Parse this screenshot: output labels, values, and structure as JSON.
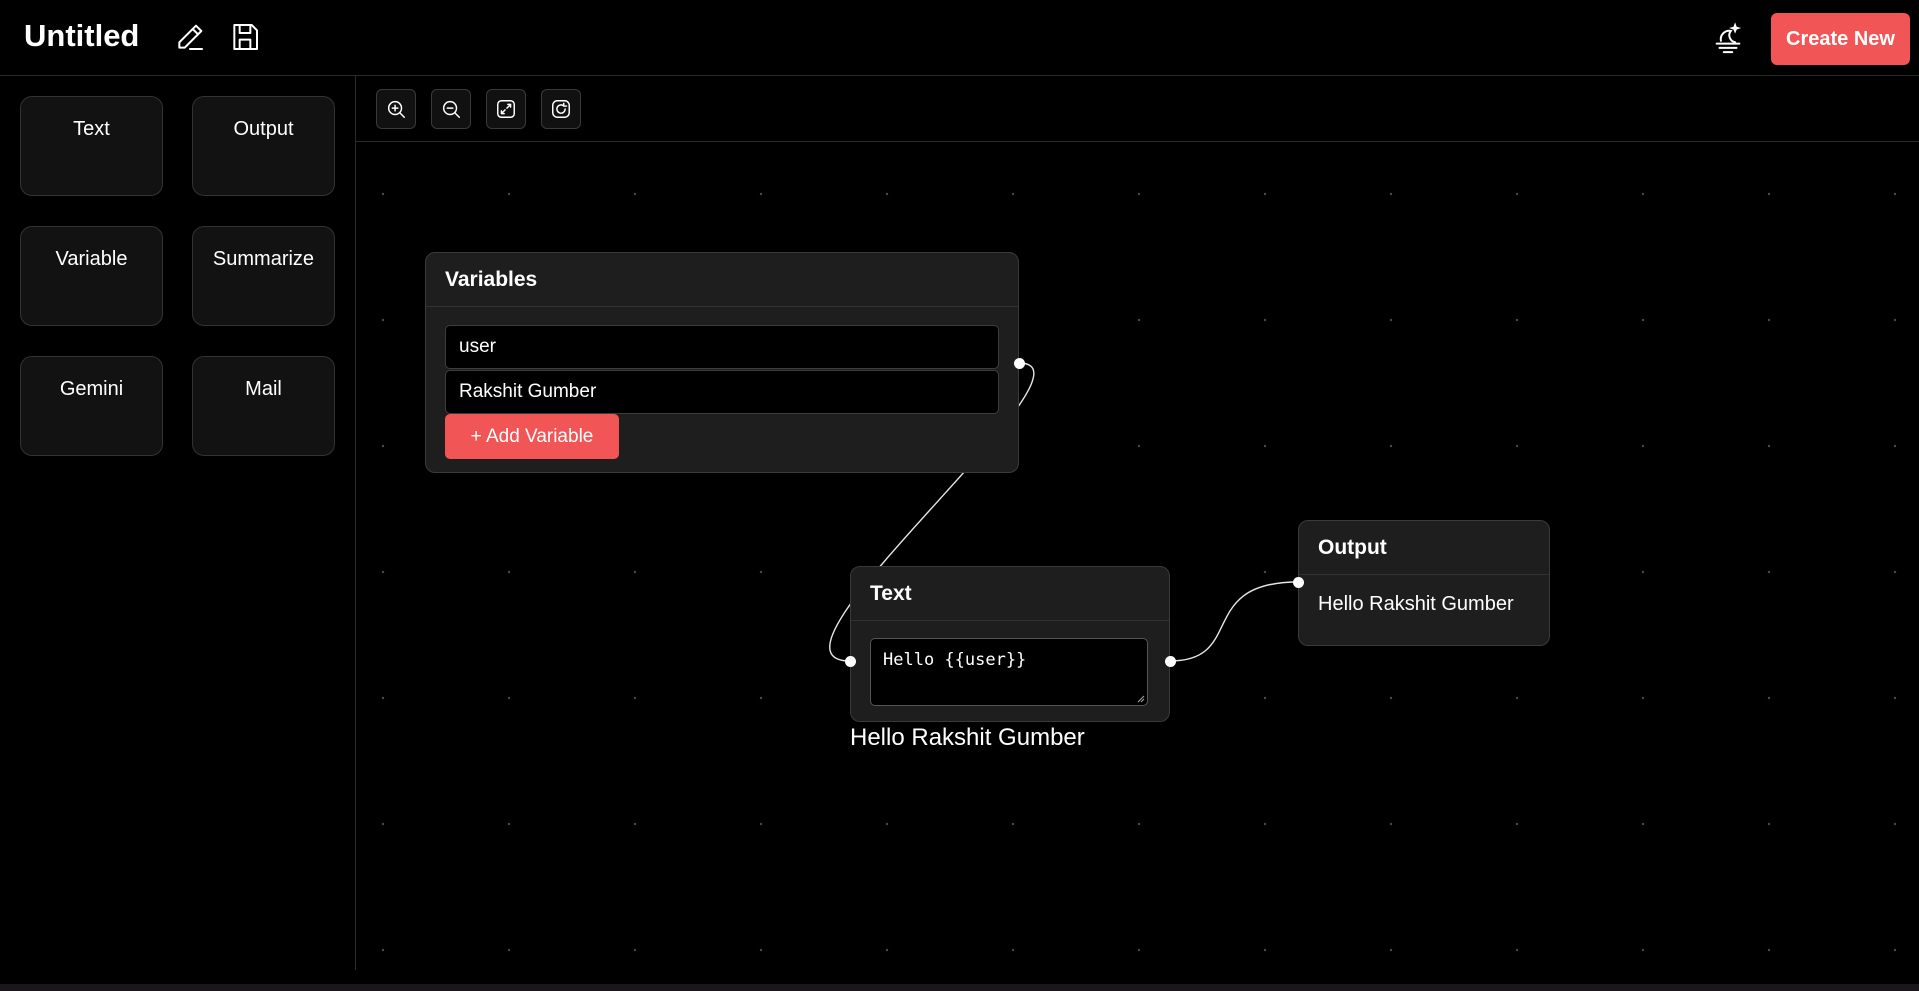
{
  "header": {
    "title": "Untitled",
    "create_label": "Create New",
    "accent_color": "#f25555"
  },
  "sidebar": {
    "tiles": [
      {
        "label": "Text"
      },
      {
        "label": "Output"
      },
      {
        "label": "Variable"
      },
      {
        "label": "Summarize"
      },
      {
        "label": "Gemini"
      },
      {
        "label": "Mail"
      }
    ]
  },
  "toolbar": {
    "icons": [
      "zoom-in-icon",
      "zoom-out-icon",
      "fit-view-icon",
      "reset-view-icon"
    ]
  },
  "nodes": {
    "variables": {
      "title": "Variables",
      "name_value": "user",
      "value_value": "Rakshit Gumber",
      "add_label": "+ Add Variable"
    },
    "text": {
      "title": "Text",
      "template": "Hello {{user}}",
      "result": "Hello Rakshit Gumber"
    },
    "output": {
      "title": "Output",
      "value": "Hello Rakshit Gumber"
    }
  }
}
